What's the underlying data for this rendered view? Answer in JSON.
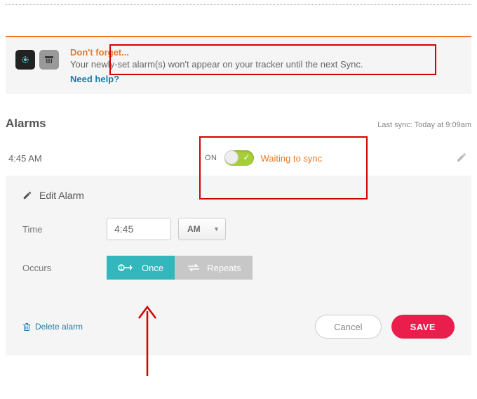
{
  "notice": {
    "title": "Don't forget...",
    "message": "Your newly-set alarm(s) won't appear on your tracker until the next Sync.",
    "help_link": "Need help?"
  },
  "alarms": {
    "header": "Alarms",
    "last_sync": "Last sync: Today at 9:09am",
    "rows": [
      {
        "time": "4:45 AM",
        "state_label": "ON",
        "sync_status": "Waiting to sync"
      }
    ]
  },
  "edit": {
    "title": "Edit Alarm",
    "fields": {
      "time_label": "Time",
      "time_value": "4:45",
      "ampm": "AM",
      "occurs_label": "Occurs",
      "once_label": "Once",
      "repeats_label": "Repeats"
    },
    "actions": {
      "delete": "Delete alarm",
      "cancel": "Cancel",
      "save": "SAVE"
    }
  },
  "icons": {
    "tracker_dots": "⁘",
    "scale": "⚖",
    "pencil": "✎",
    "trash": "🗑",
    "one": "1",
    "repeat": "↻"
  }
}
